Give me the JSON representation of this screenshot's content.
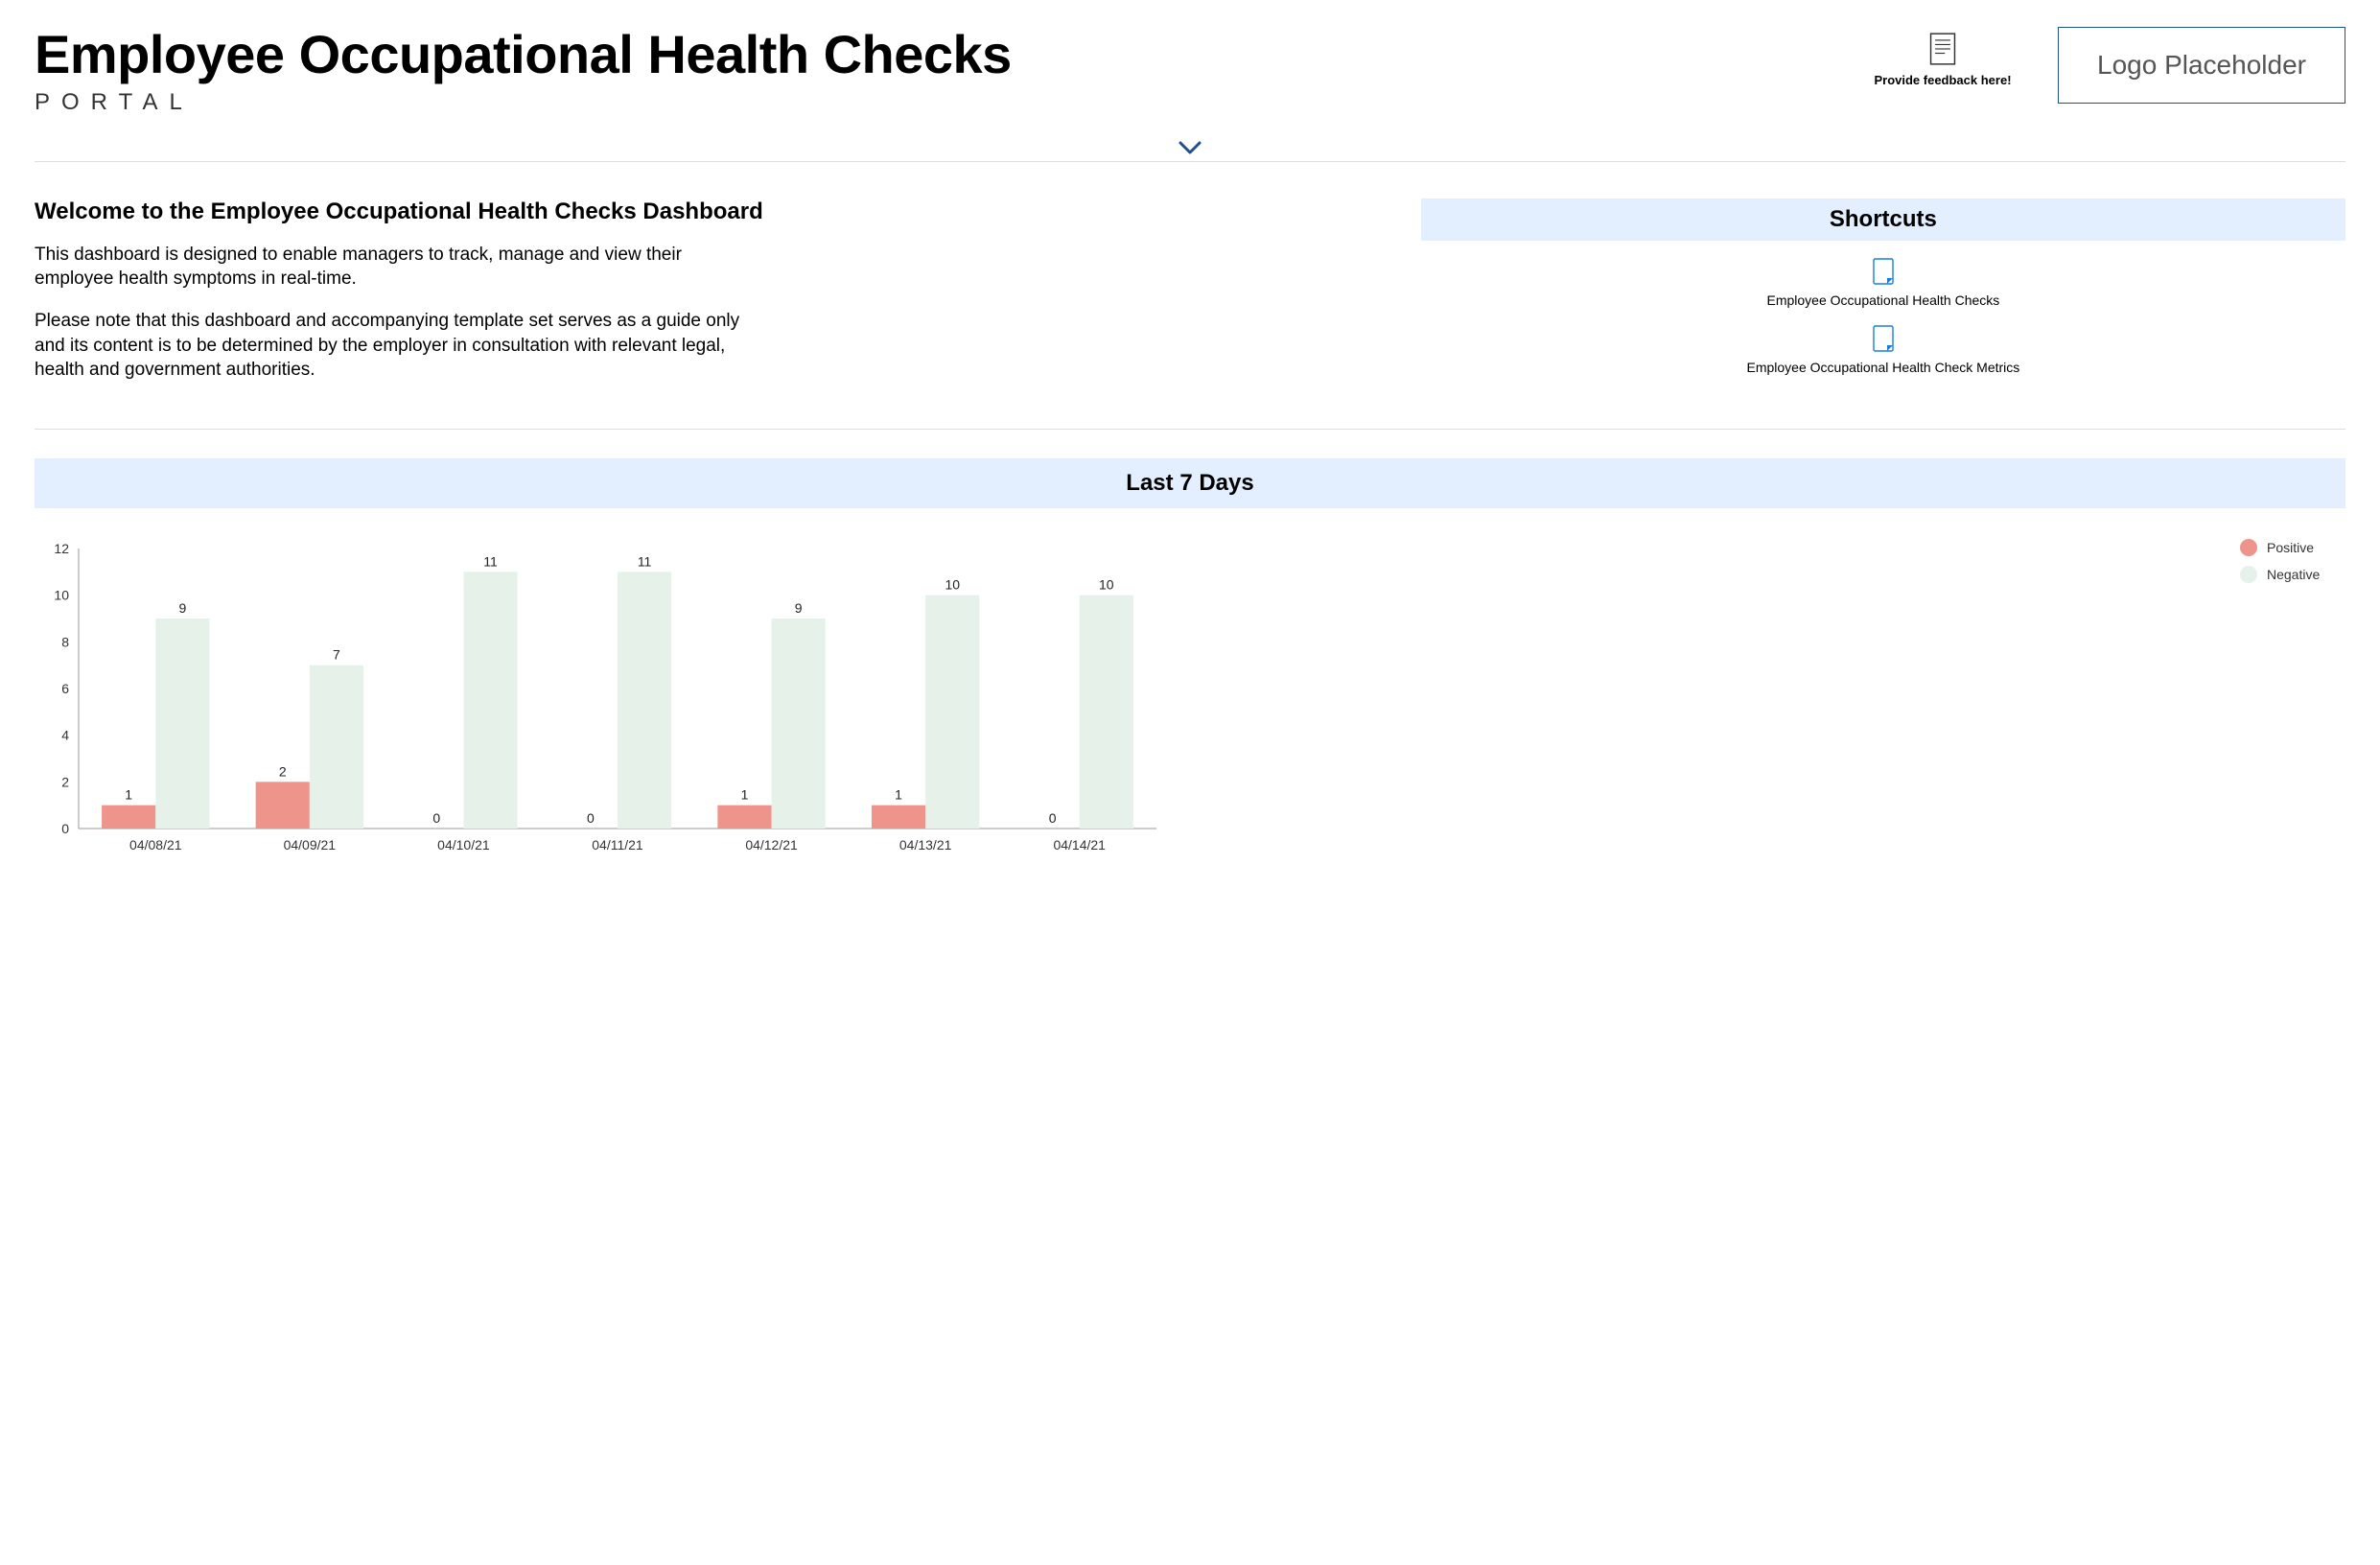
{
  "header": {
    "title": "Employee Occupational Health Checks",
    "subtitle": "PORTAL",
    "feedback": "Provide feedback here!",
    "logo_text": "Logo Placeholder"
  },
  "welcome": {
    "heading": "Welcome to the Employee Occupational Health Checks Dashboard",
    "p1": "This dashboard is designed to enable managers to track, manage and view their employee health symptoms in real-time.",
    "p2": "Please note that this dashboard and accompanying template set serves as a guide only and its content is to be determined by the employer in consultation with relevant legal, health and government authorities."
  },
  "shortcuts": {
    "title": "Shortcuts",
    "items": [
      {
        "label": "Employee Occupational Health Checks"
      },
      {
        "label": "Employee Occupational Health Check Metrics"
      }
    ]
  },
  "chart_section": {
    "title": "Last 7 Days"
  },
  "legend": {
    "positive": "Positive",
    "negative": "Negative"
  },
  "colors": {
    "positive": "#ee948a",
    "negative": "#e6f2e9",
    "section_bg": "#e3efff",
    "border_blue": "#1f4f8f"
  },
  "chart_data": {
    "type": "bar",
    "title": "Last 7 Days",
    "ylabel": "",
    "xlabel": "",
    "ylim": [
      0,
      12
    ],
    "yticks": [
      0,
      2,
      4,
      6,
      8,
      10,
      12
    ],
    "categories": [
      "04/08/21",
      "04/09/21",
      "04/10/21",
      "04/11/21",
      "04/12/21",
      "04/13/21",
      "04/14/21"
    ],
    "series": [
      {
        "name": "Positive",
        "color": "#ee948a",
        "values": [
          1,
          2,
          0,
          0,
          1,
          1,
          0
        ]
      },
      {
        "name": "Negative",
        "color": "#e6f2e9",
        "values": [
          9,
          7,
          11,
          11,
          9,
          10,
          10
        ]
      }
    ]
  }
}
